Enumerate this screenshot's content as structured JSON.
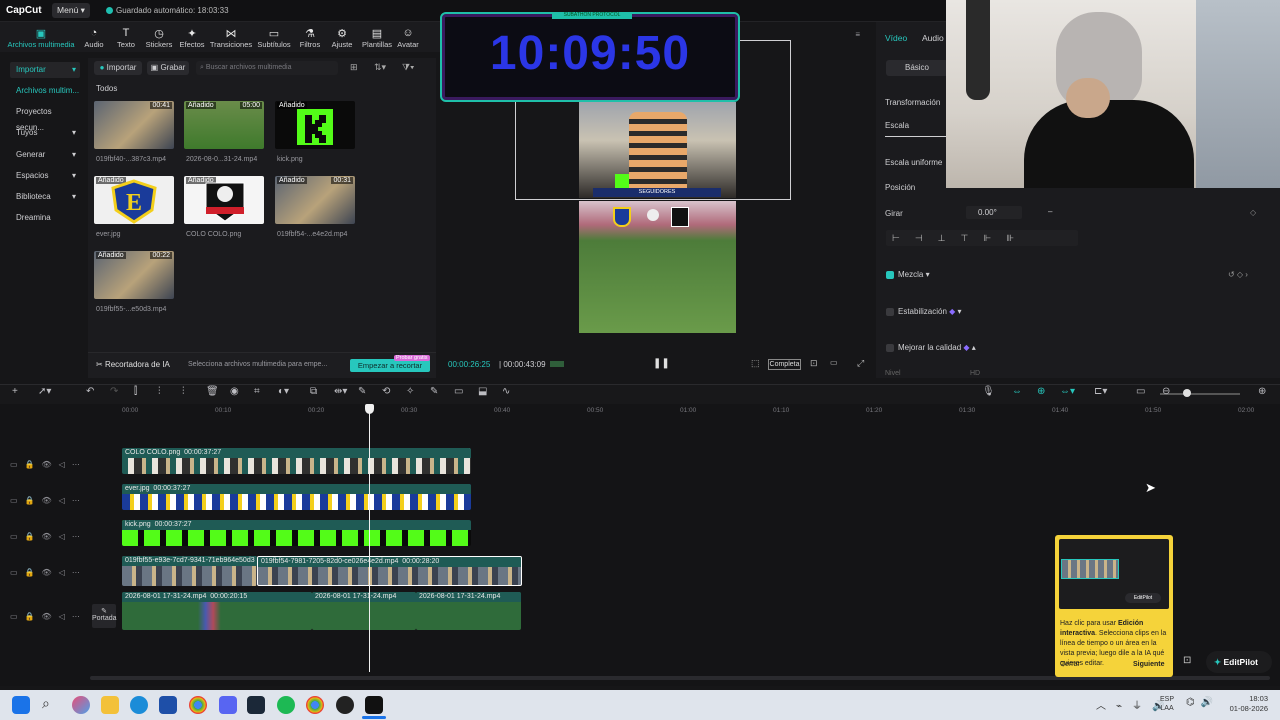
{
  "app": {
    "logo": "CapCut",
    "menu_label": "Menú",
    "autosave": "Guardado automático: 18:03:33"
  },
  "toolbar": {
    "items": [
      {
        "label": "Archivos multimedia",
        "icon": "media-icon"
      },
      {
        "label": "Audio",
        "icon": "audio-icon"
      },
      {
        "label": "Texto",
        "icon": "text-icon"
      },
      {
        "label": "Stickers",
        "icon": "sticker-icon"
      },
      {
        "label": "Efectos",
        "icon": "effects-icon"
      },
      {
        "label": "Transiciones",
        "icon": "transitions-icon"
      },
      {
        "label": "Subtítulos",
        "icon": "subtitles-icon"
      },
      {
        "label": "Filtros",
        "icon": "filters-icon"
      },
      {
        "label": "Ajuste",
        "icon": "adjust-icon"
      },
      {
        "label": "Plantillas",
        "icon": "templates-icon"
      },
      {
        "label": "Avatar",
        "icon": "avatar-icon"
      }
    ]
  },
  "left_nav": {
    "items": [
      "Importar",
      "Archivos multim...",
      "Proyectos secun...",
      "Tuyos",
      "Generar",
      "Espacios",
      "Biblioteca",
      "Dreamina"
    ]
  },
  "media": {
    "import_label": "Importar",
    "record_label": "Grabar",
    "search_placeholder": "Buscar archivos multimedia",
    "section_title": "Todos",
    "items": [
      {
        "tag": "",
        "duration": "00:41",
        "name": "019fbf40-...387c3.mp4"
      },
      {
        "tag": "Añadido",
        "duration": "05:00",
        "name": "2026-08-0...31-24.mp4"
      },
      {
        "tag": "Añadido",
        "duration": "",
        "name": "kick.png"
      },
      {
        "tag": "Añadido",
        "duration": "",
        "name": "ever.jpg"
      },
      {
        "tag": "Añadido",
        "duration": "",
        "name": "COLO COLO.png"
      },
      {
        "tag": "Añadido",
        "duration": "00:31",
        "name": "019fbf54-...e4e2d.mp4"
      },
      {
        "tag": "Añadido",
        "duration": "00:22",
        "name": "019fbf55-...e50d3.mp4"
      }
    ],
    "ai_recorder": "Recortadora de IA",
    "ai_hint": "Selecciona archivos multimedia para empe...",
    "ai_button": "Empezar a recortar",
    "ai_badge": "Probar gratis"
  },
  "preview": {
    "timer": "10:09:50",
    "timer_caption": "SUBATHON PROTOCOL",
    "time_current": "00:00:26:25",
    "time_total": "00:00:43:09",
    "full_label": "Completa",
    "followers_label": "SEGUIDORES"
  },
  "right_panel": {
    "tabs": [
      "Vídeo",
      "Audio"
    ],
    "basic_tab": "Básico",
    "transform_label": "Transformación",
    "scale_label": "Escala",
    "uniform_scale": "Escala uniforme",
    "position_label": "Posición",
    "rotate_label": "Girar",
    "rotate_value": "0.00°",
    "blend_label": "Mezcla",
    "stabilize_label": "Estabilización",
    "quality_label": "Mejorar la calidad",
    "level_label": "Nivel",
    "level_value": "HD"
  },
  "timeline": {
    "ruler": [
      "00:00",
      "00:10",
      "00:20",
      "00:30",
      "00:40",
      "00:50",
      "01:00",
      "01:10",
      "01:20",
      "01:30",
      "01:40",
      "01:50",
      "02:00"
    ],
    "tracks": [
      {
        "label": "COLO COLO.png",
        "duration": "00:00:37:27"
      },
      {
        "label": "ever.jpg",
        "duration": "00:00:37:27"
      },
      {
        "label": "kick.png",
        "duration": "00:00:37:27"
      },
      {
        "label": "019fbf55-e93e-7cd7-9341-71eb964e50d3",
        "duration": "",
        "label2": "019fbf54-7981-7205-82d0-ce026e4e2d.mp4",
        "duration2": "00:00:28:20"
      },
      {
        "label": "2026-08-01 17-31-24.mp4",
        "duration": "00:00:20:15",
        "label2": "2026-08-01 17-31-24.mp4",
        "label3": "2026-08-01 17-31-24.mp4"
      }
    ],
    "cover_label": "Portada"
  },
  "popup": {
    "text_prefix": "Haz clic para usar ",
    "text_bold": "Edición interactiva",
    "text_suffix": ". Selecciona clips en la línea de tiempo o un área en la vista previa; luego dile a la IA qué quieres editar.",
    "close_label": "Cerrar",
    "next_label": "Siguiente",
    "editpilot_label": "EditPilot"
  },
  "taskbar": {
    "lang": "ESP",
    "lang2": "LAA",
    "time": "18:03",
    "date": "01-08-2026"
  },
  "colors": {
    "accent": "#27c7bd",
    "timer_blue": "#2b36e6",
    "clip_teal": "#1f5b55",
    "clip_green": "#1f6a3a",
    "popup_yellow": "#f5d33a"
  }
}
